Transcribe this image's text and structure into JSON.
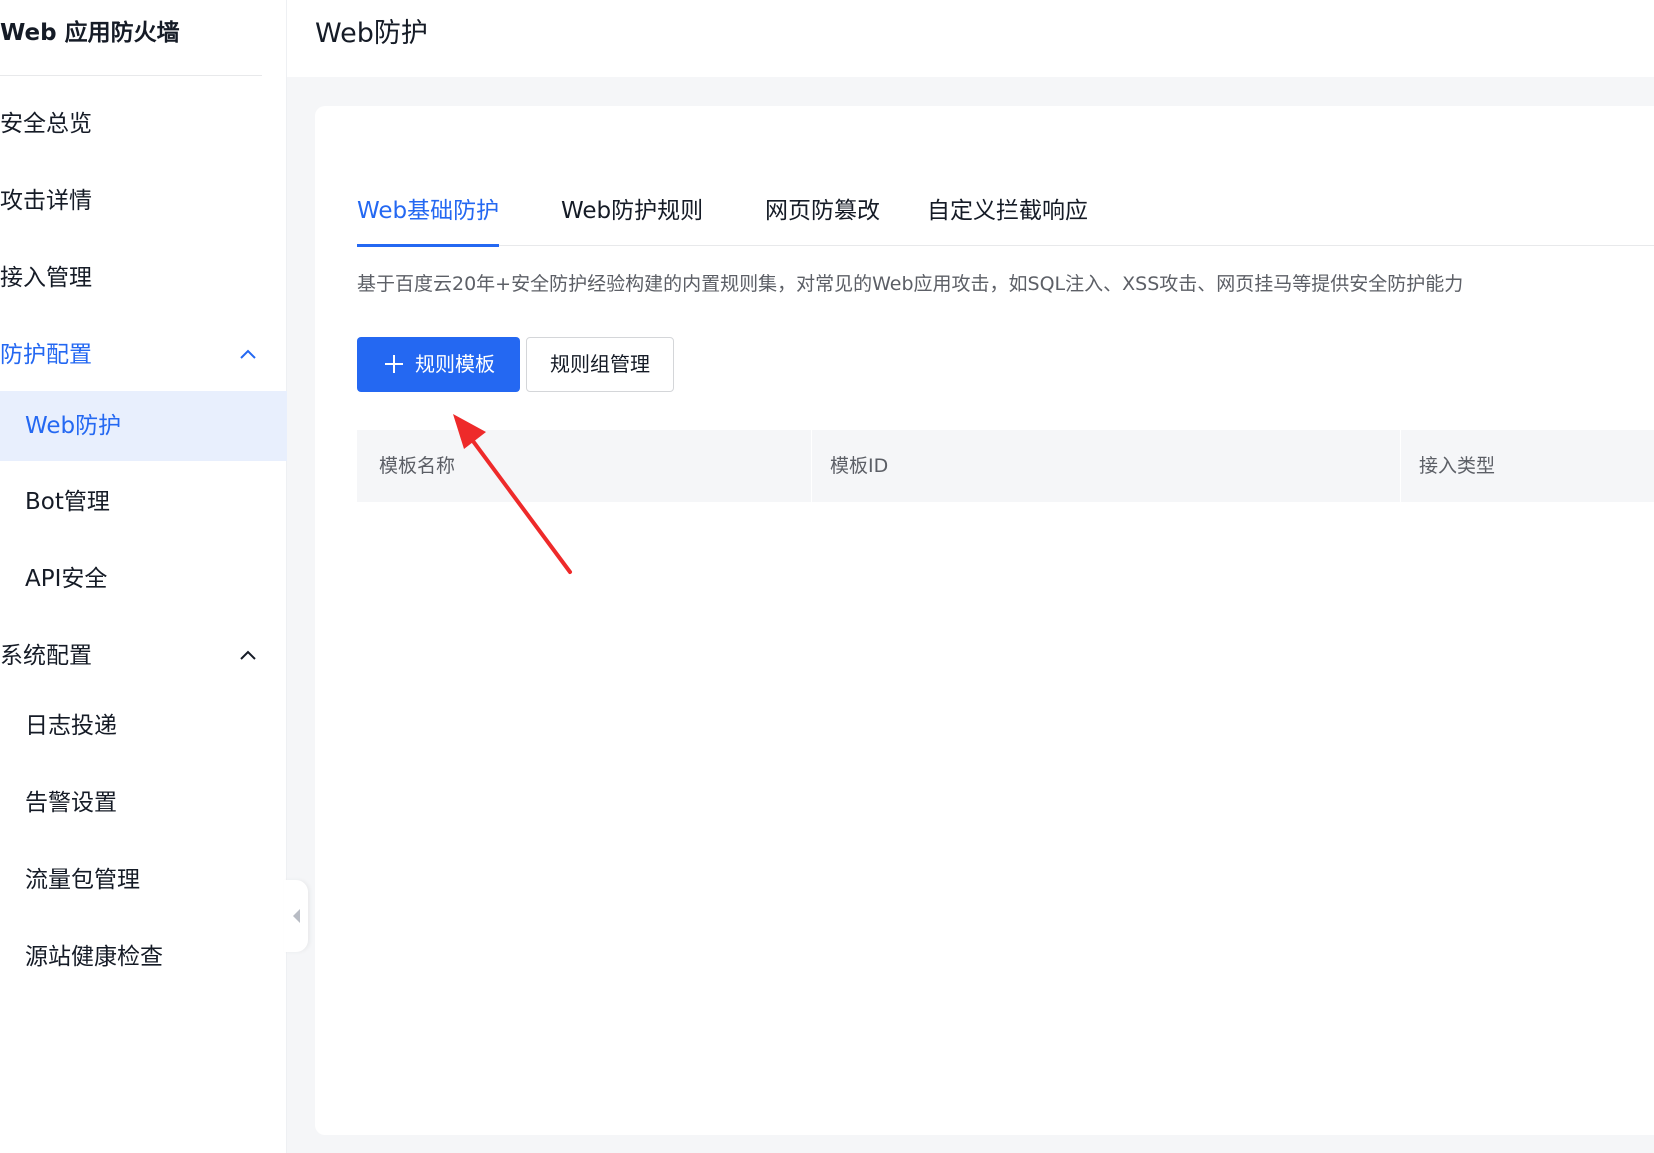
{
  "sidebar": {
    "title": "Web 应用防火墙",
    "items": [
      {
        "label": "安全总览"
      },
      {
        "label": "攻击详情"
      },
      {
        "label": "接入管理"
      },
      {
        "label": "防护配置"
      },
      {
        "label": "Web防护"
      },
      {
        "label": "Bot管理"
      },
      {
        "label": "API安全"
      },
      {
        "label": "系统配置"
      },
      {
        "label": "日志投递"
      },
      {
        "label": "告警设置"
      },
      {
        "label": "流量包管理"
      },
      {
        "label": "源站健康检查"
      }
    ]
  },
  "header": {
    "title": "Web防护"
  },
  "tabs": [
    {
      "label": "Web基础防护",
      "active": true
    },
    {
      "label": "Web防护规则"
    },
    {
      "label": "网页防篡改"
    },
    {
      "label": "自定义拦截响应"
    }
  ],
  "description": "基于百度云20年+安全防护经验构建的内置规则集，对常见的Web应用攻击，如SQL注入、XSS攻击、网页挂马等提供安全防护能力",
  "actions": {
    "add_template_label": "规则模板",
    "group_manage_label": "规则组管理"
  },
  "table": {
    "columns": [
      "模板名称",
      "模板ID",
      "接入类型"
    ]
  },
  "colors": {
    "accent": "#2468f2",
    "annotation_arrow": "#ee2a2a"
  },
  "icons": {
    "group_expand": "chevron-up-icon",
    "add": "plus-icon",
    "collapse": "caret-left-icon"
  }
}
